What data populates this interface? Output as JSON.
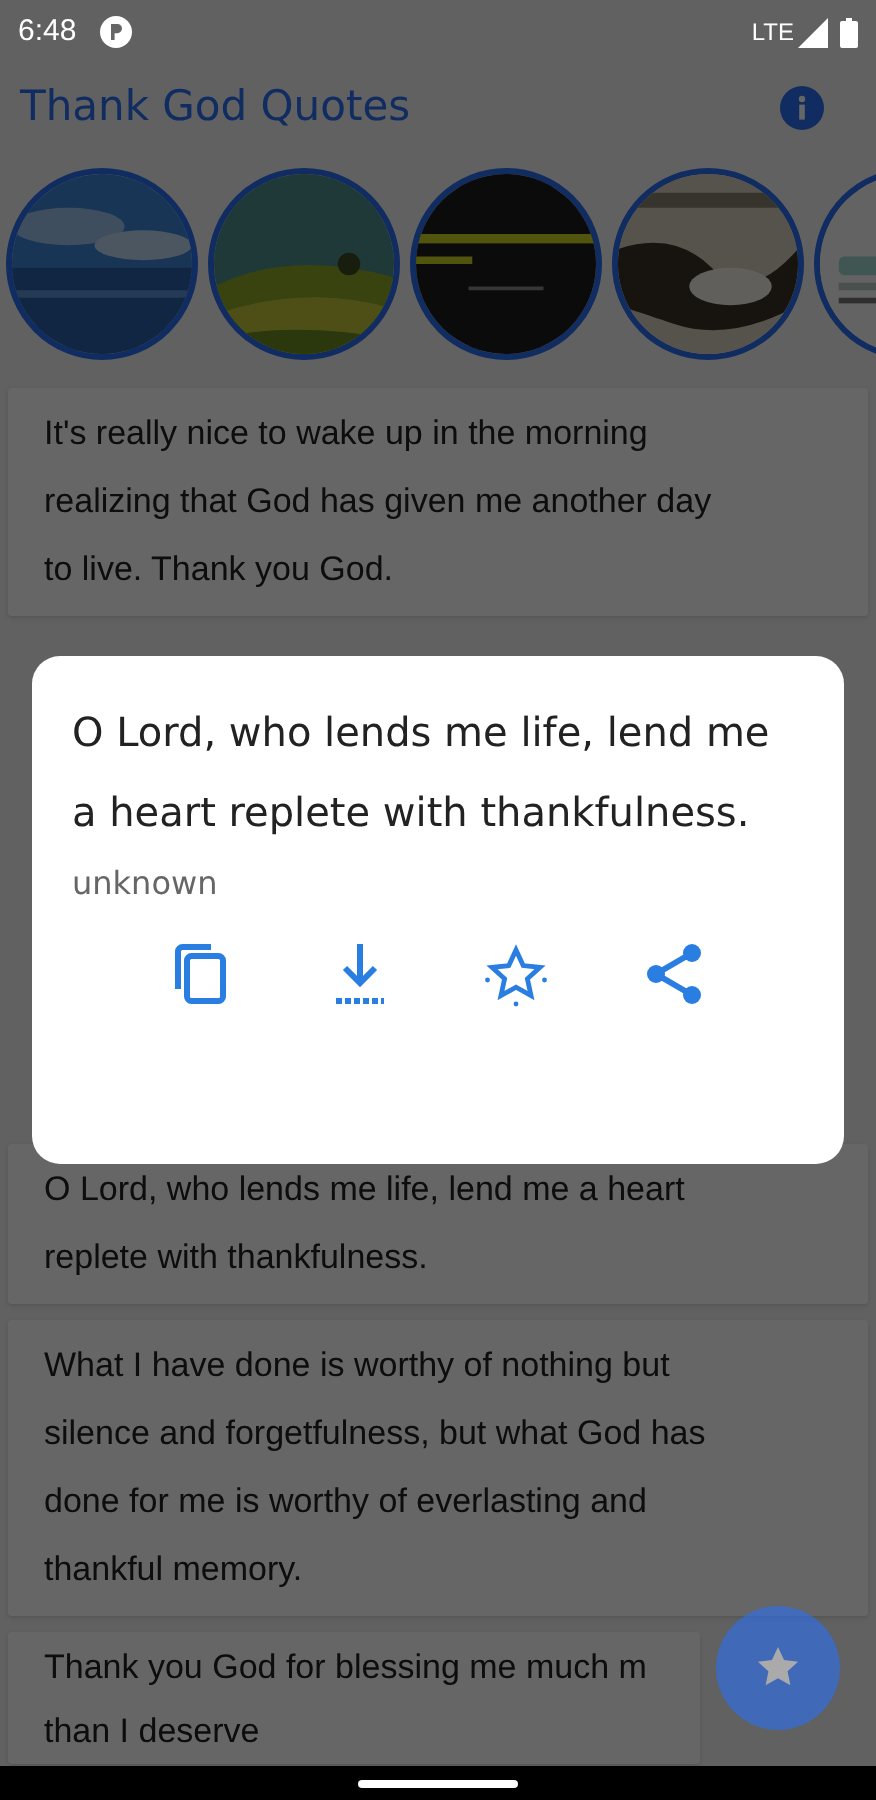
{
  "status_bar": {
    "time": "6:48",
    "network": "LTE"
  },
  "app_bar": {
    "title": "Thank God Quotes"
  },
  "quotes": [
    {
      "lines": [
        "It's really nice to wake up in the morning",
        "realizing that God has given me another day",
        "to live. Thank you God."
      ],
      "behind_dialog": false
    },
    {
      "lines": [
        "O Lord, who lends me life, lend me a heart",
        "replete with thankfulness."
      ],
      "behind_dialog": true
    },
    {
      "lines": [
        "What I have done is worthy of nothing but",
        "silence and forgetfulness, but what God has",
        "done for me is worthy of everlasting and",
        "thankful memory."
      ],
      "behind_dialog": false
    },
    {
      "lines": [
        "Thank you God for blessing me much m",
        "than I deserve"
      ],
      "behind_dialog": false
    }
  ],
  "dialog": {
    "quote": "O Lord, who lends me life, lend me a heart replete with thankfulness.",
    "author": "unknown",
    "actions": [
      {
        "kind": "copy"
      },
      {
        "kind": "download"
      },
      {
        "kind": "favorite"
      },
      {
        "kind": "share"
      }
    ]
  }
}
